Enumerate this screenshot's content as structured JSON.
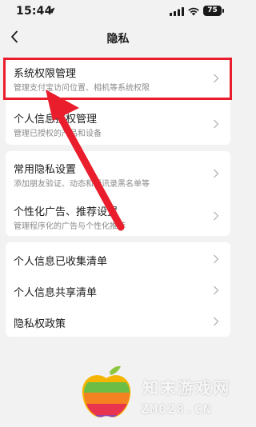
{
  "status_bar": {
    "time": "15:44",
    "battery": "75"
  },
  "header": {
    "title": "隐私"
  },
  "sections": [
    {
      "items": [
        {
          "title": "系统权限管理",
          "subtitle": "管理支付宝访问位置、相机等系统权限",
          "highlighted": true
        },
        {
          "title": "个人信息授权管理",
          "subtitle": "管理已授权的产品和设备"
        }
      ]
    },
    {
      "items": [
        {
          "title": "常用隐私设置",
          "subtitle": "添加朋友验证、动态和通讯录黑名单等"
        },
        {
          "title": "个性化广告、推荐设置",
          "subtitle": "管理程序化的广告与个性化推荐"
        }
      ]
    },
    {
      "items": [
        {
          "title": "个人信息已收集清单"
        },
        {
          "title": "个人信息共享清单"
        },
        {
          "title": "隐私权政策"
        }
      ]
    }
  ],
  "watermark": {
    "name": "知末游戏网",
    "domain": "ZM028.CN"
  },
  "colors": {
    "highlight": "#ea1d2c",
    "background": "#f2f2f2"
  }
}
